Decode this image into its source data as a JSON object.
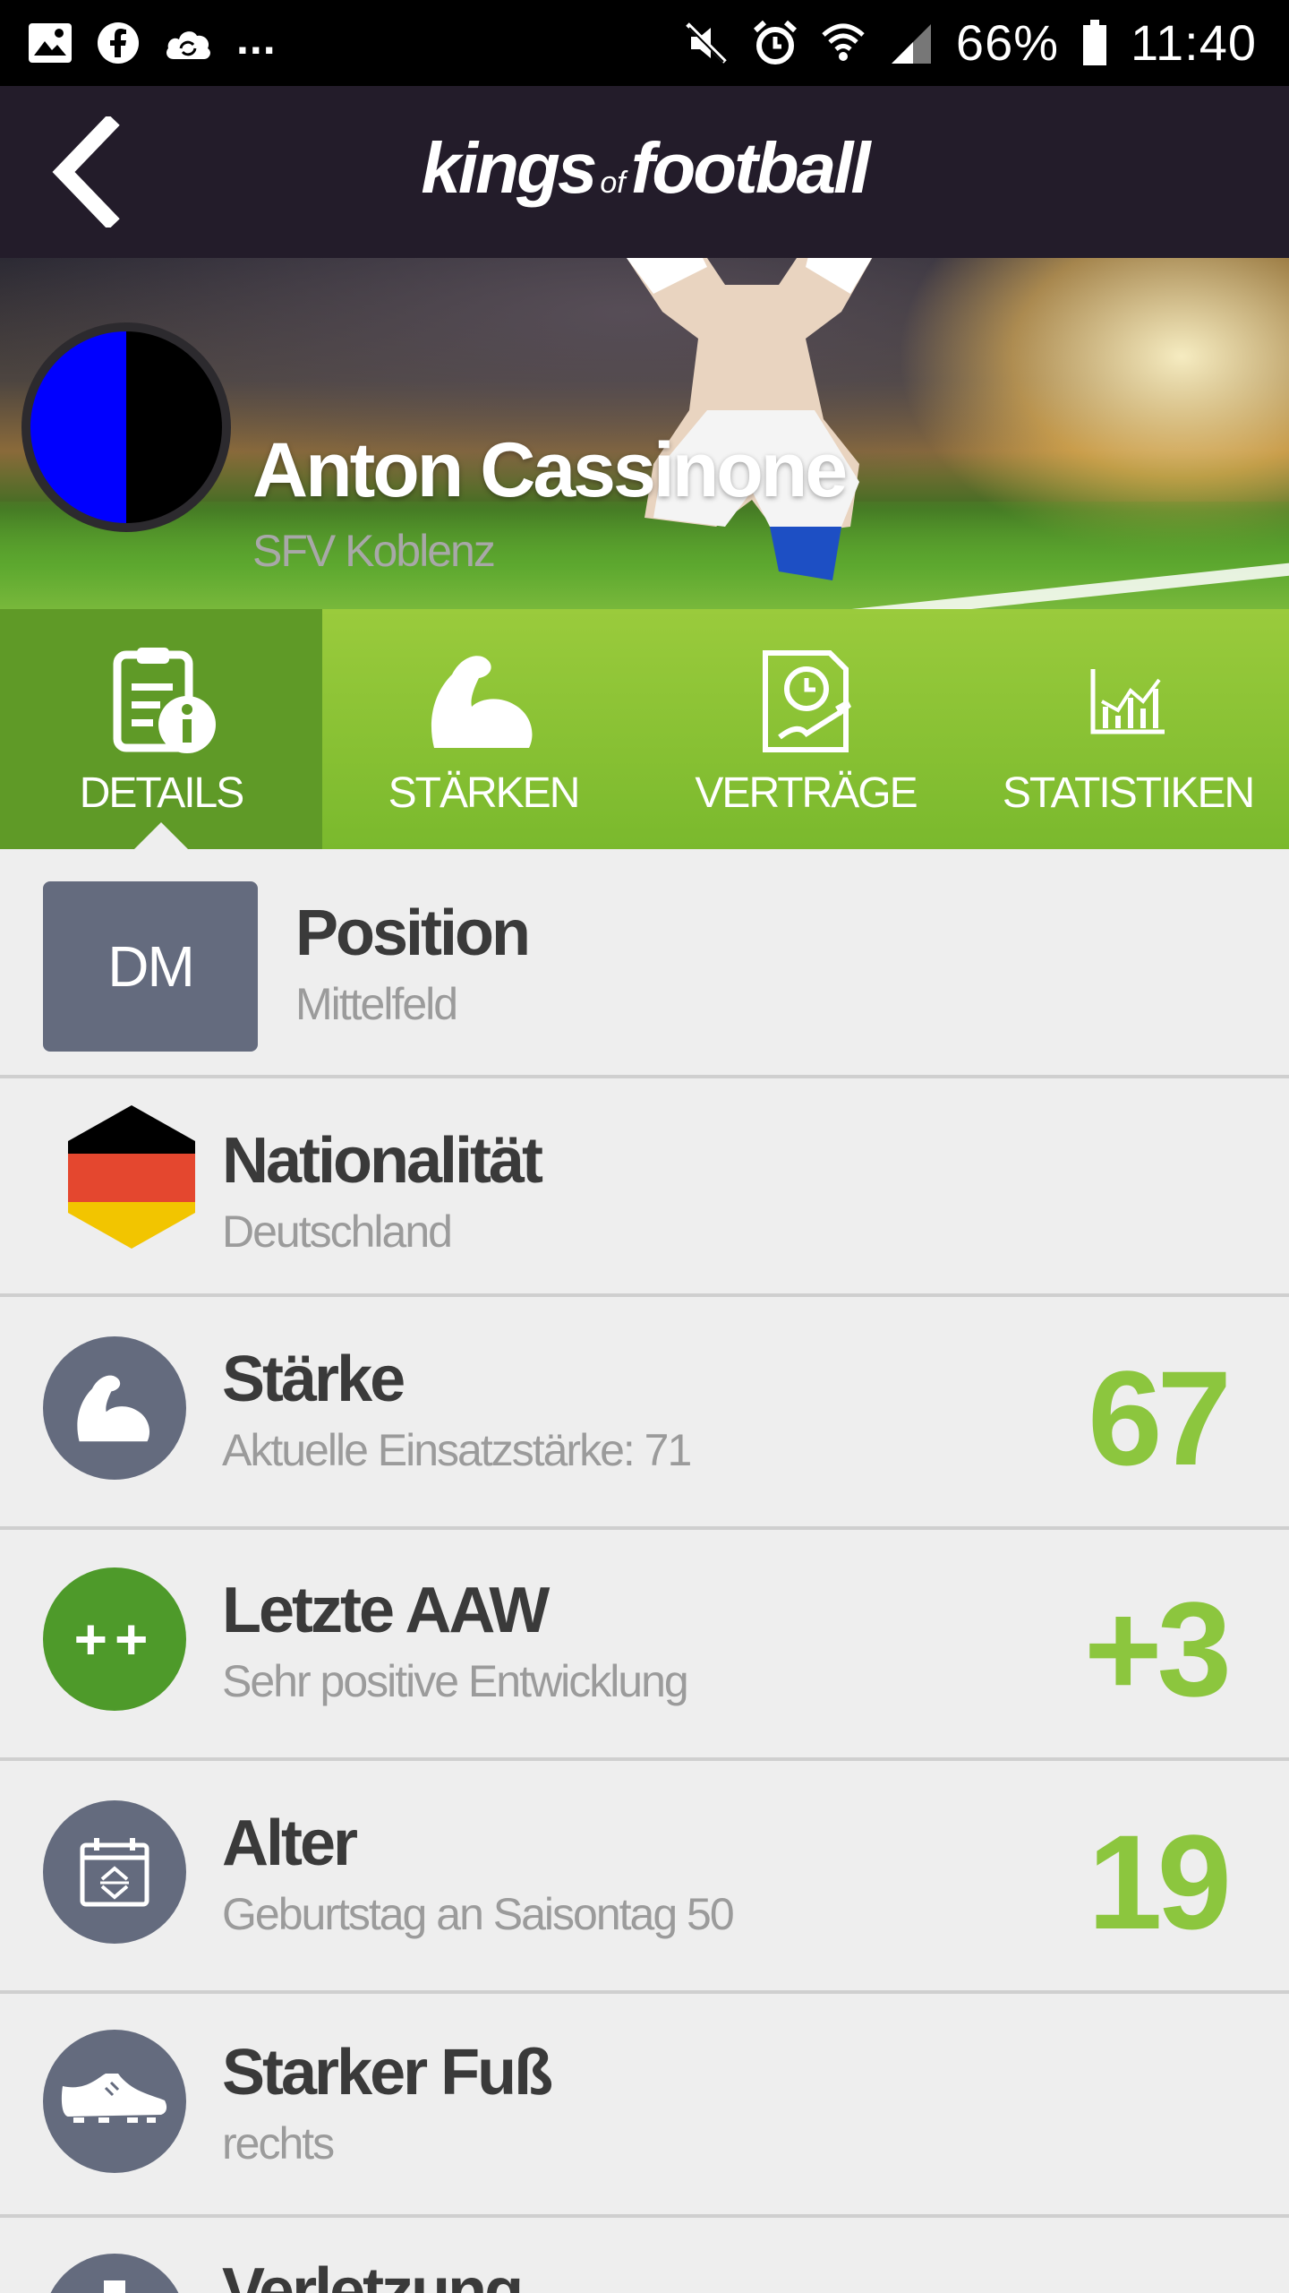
{
  "status_bar": {
    "left_icons": [
      "image-icon",
      "facebook-icon",
      "cloud-sync-icon"
    ],
    "more": "...",
    "right_icons": [
      "mute-icon",
      "alarm-icon",
      "wifi-icon",
      "signal-icon"
    ],
    "battery": "66%",
    "time": "11:40"
  },
  "header": {
    "logo_main": "kings",
    "logo_of": "of",
    "logo_end": "football"
  },
  "hero": {
    "player_name": "Anton Cassinone",
    "club": "SFV Koblenz",
    "badge_colors": [
      "#0000ff",
      "#000000"
    ]
  },
  "tabs": [
    {
      "label": "DETAILS",
      "icon": "details-icon",
      "active": true
    },
    {
      "label": "STÄRKEN",
      "icon": "muscle-icon",
      "active": false
    },
    {
      "label": "VERTRÄGE",
      "icon": "contract-icon",
      "active": false
    },
    {
      "label": "STATISTIKEN",
      "icon": "stats-icon",
      "active": false
    }
  ],
  "details": {
    "position": {
      "badge": "DM",
      "title": "Position",
      "subtitle": "Mittelfeld"
    },
    "nationality": {
      "title": "Nationalität",
      "subtitle": "Deutschland",
      "flag_colors": [
        "#000000",
        "#e4472f",
        "#f2c500"
      ]
    },
    "strength": {
      "title": "Stärke",
      "subtitle": "Aktuelle Einsatzstärke: 71",
      "value": "67",
      "icon": "muscle-icon"
    },
    "last_aaw": {
      "title": "Letzte AAW",
      "subtitle": "Sehr positive Entwicklung",
      "value": "+3",
      "icon_text": "++"
    },
    "age": {
      "title": "Alter",
      "subtitle": "Geburtstag an Saisontag 50",
      "value": "19",
      "icon": "calendar-icon"
    },
    "foot": {
      "title": "Starker Fuß",
      "subtitle": "rechts",
      "icon": "boot-icon"
    },
    "injury": {
      "title": "Verletzung",
      "icon": "injury-icon"
    }
  },
  "colors": {
    "accent_green": "#8cc63e",
    "tab_green": "#7ab92d",
    "tab_active": "#5f9a27",
    "header_dark": "#231c2a",
    "icon_gray": "#646b7e"
  }
}
